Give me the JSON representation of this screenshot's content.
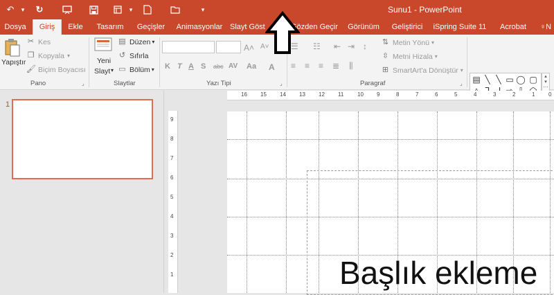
{
  "window": {
    "title": "Sunu1 - PowerPoint"
  },
  "quick_access": [
    "undo-icon",
    "redo-icon",
    "present-icon",
    "save-icon",
    "layout-icon",
    "new-file-icon",
    "open-folder-icon",
    "customize-icon"
  ],
  "tabs": [
    {
      "label": "Dosya"
    },
    {
      "label": "Giriş"
    },
    {
      "label": "Ekle"
    },
    {
      "label": "Tasarım"
    },
    {
      "label": "Geçişler"
    },
    {
      "label": "Animasyonlar"
    },
    {
      "label": "Slayt Göst"
    },
    {
      "label": "Gözden Geçir"
    },
    {
      "label": "Görünüm"
    },
    {
      "label": "Geliştirici"
    },
    {
      "label": "iSpring Suite 11"
    },
    {
      "label": "Acrobat"
    },
    {
      "label": "N"
    }
  ],
  "ribbon": {
    "pano": {
      "label": "Pano",
      "paste": "Yapıştır",
      "cut": "Kes",
      "copy": "Kopyala",
      "format_painter": "Biçim Boyacısı"
    },
    "slaytlar": {
      "label": "Slaytlar",
      "new_slide_1": "Yeni",
      "new_slide_2": "Slayt",
      "layout": "Düzen",
      "reset": "Sıfırla",
      "section": "Bölüm"
    },
    "yazi_tipi": {
      "label": "Yazı Tipi",
      "buttons": [
        "K",
        "T",
        "A",
        "S",
        "abc",
        "AV",
        "Aa",
        "A"
      ]
    },
    "paragraf": {
      "label": "Paragraf",
      "text_direction": "Metin Yönü",
      "align_text": "Metni Hizala",
      "smartart": "SmartArt'a Dönüştür"
    },
    "shapes": [
      "text-box-icon",
      "line-icon",
      "line-diag-icon",
      "rect-icon",
      "oval-icon",
      "rounded-rect-icon",
      "triangle-icon",
      "elbow-icon",
      "elbow2-icon",
      "arrow-right-icon",
      "arrow-down-icon",
      "pentagon-icon",
      "rect2-icon",
      "curve-icon",
      "arc-icon",
      "brace-left-icon",
      "brace-right-icon",
      "star-icon"
    ]
  },
  "slide_panel": {
    "slide_number": "1"
  },
  "ruler": {
    "horizontal": [
      "16",
      "15",
      "14",
      "13",
      "12",
      "11",
      "10",
      "9",
      "8",
      "7",
      "6",
      "5",
      "4",
      "3",
      "2",
      "1",
      "0"
    ],
    "vertical": [
      "9",
      "8",
      "7",
      "6",
      "5",
      "4",
      "3",
      "2",
      "1"
    ]
  },
  "slide": {
    "title_text": "Başlık ekleme"
  }
}
